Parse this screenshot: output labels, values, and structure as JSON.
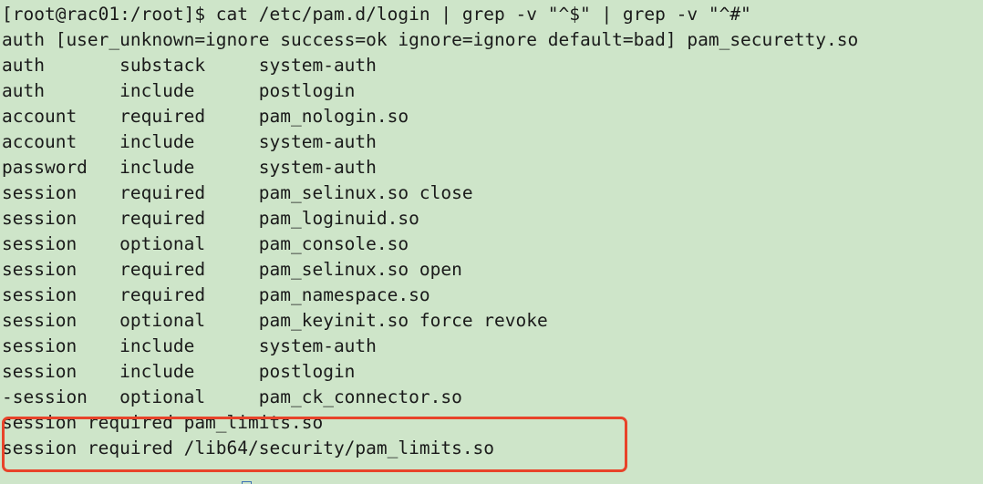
{
  "terminal": {
    "colors": {
      "background": "#cee5c9",
      "foreground": "#1a1a1a",
      "highlight_border": "#e8432a",
      "cursor": "#3a6fb5"
    },
    "prompt": "[root@rac01:/root]$",
    "command": "cat /etc/pam.d/login | grep -v \"^$\" | grep -v \"^#\"",
    "prompt_line": "[root@rac01:/root]$ cat /etc/pam.d/login | grep -v \"^$\" | grep -v \"^#\"",
    "output_lines": [
      "auth [user_unknown=ignore success=ok ignore=ignore default=bad] pam_securetty.so",
      "auth       substack     system-auth",
      "auth       include      postlogin",
      "account    required     pam_nologin.so",
      "account    include      system-auth",
      "password   include      system-auth",
      "session    required     pam_selinux.so close",
      "session    required     pam_loginuid.so",
      "session    optional     pam_console.so",
      "session    required     pam_selinux.so open",
      "session    required     pam_namespace.so",
      "session    optional     pam_keyinit.so force revoke",
      "session    include      system-auth",
      "session    include      postlogin",
      "-session   optional     pam_ck_connector.so"
    ],
    "highlighted_lines": [
      "session required pam_limits.so",
      "session required /lib64/security/pam_limits.so"
    ]
  }
}
